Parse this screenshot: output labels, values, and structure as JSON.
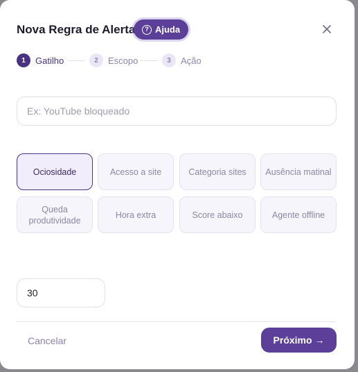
{
  "dialog": {
    "title": "Nova Regra de Alerta",
    "help_label": "Ajuda",
    "help_icon": "?",
    "close_icon": "close-icon"
  },
  "steps": [
    {
      "number": "1",
      "label": "Gatilho",
      "state": "active"
    },
    {
      "number": "2",
      "label": "Escopo",
      "state": "idle"
    },
    {
      "number": "3",
      "label": "Ação",
      "state": "idle"
    }
  ],
  "name_field": {
    "value": "",
    "placeholder": "Ex: YouTube bloqueado"
  },
  "triggers": [
    {
      "label": "Ociosidade",
      "selected": true
    },
    {
      "label": "Acesso a site",
      "selected": false
    },
    {
      "label": "Categoria sites",
      "selected": false
    },
    {
      "label": "Ausência matinal",
      "selected": false
    },
    {
      "label": "Queda produtividade",
      "selected": false
    },
    {
      "label": "Hora extra",
      "selected": false
    },
    {
      "label": "Score abaixo",
      "selected": false
    },
    {
      "label": "Agente offline",
      "selected": false
    }
  ],
  "threshold_field": {
    "value": "30"
  },
  "footer": {
    "cancel_label": "Cancelar",
    "next_label": "Próximo →"
  },
  "colors": {
    "accent": "#5b3f98",
    "accent_dark": "#4a3282",
    "muted_text": "#8d84a8",
    "card_bg": "#f7f5fc"
  }
}
